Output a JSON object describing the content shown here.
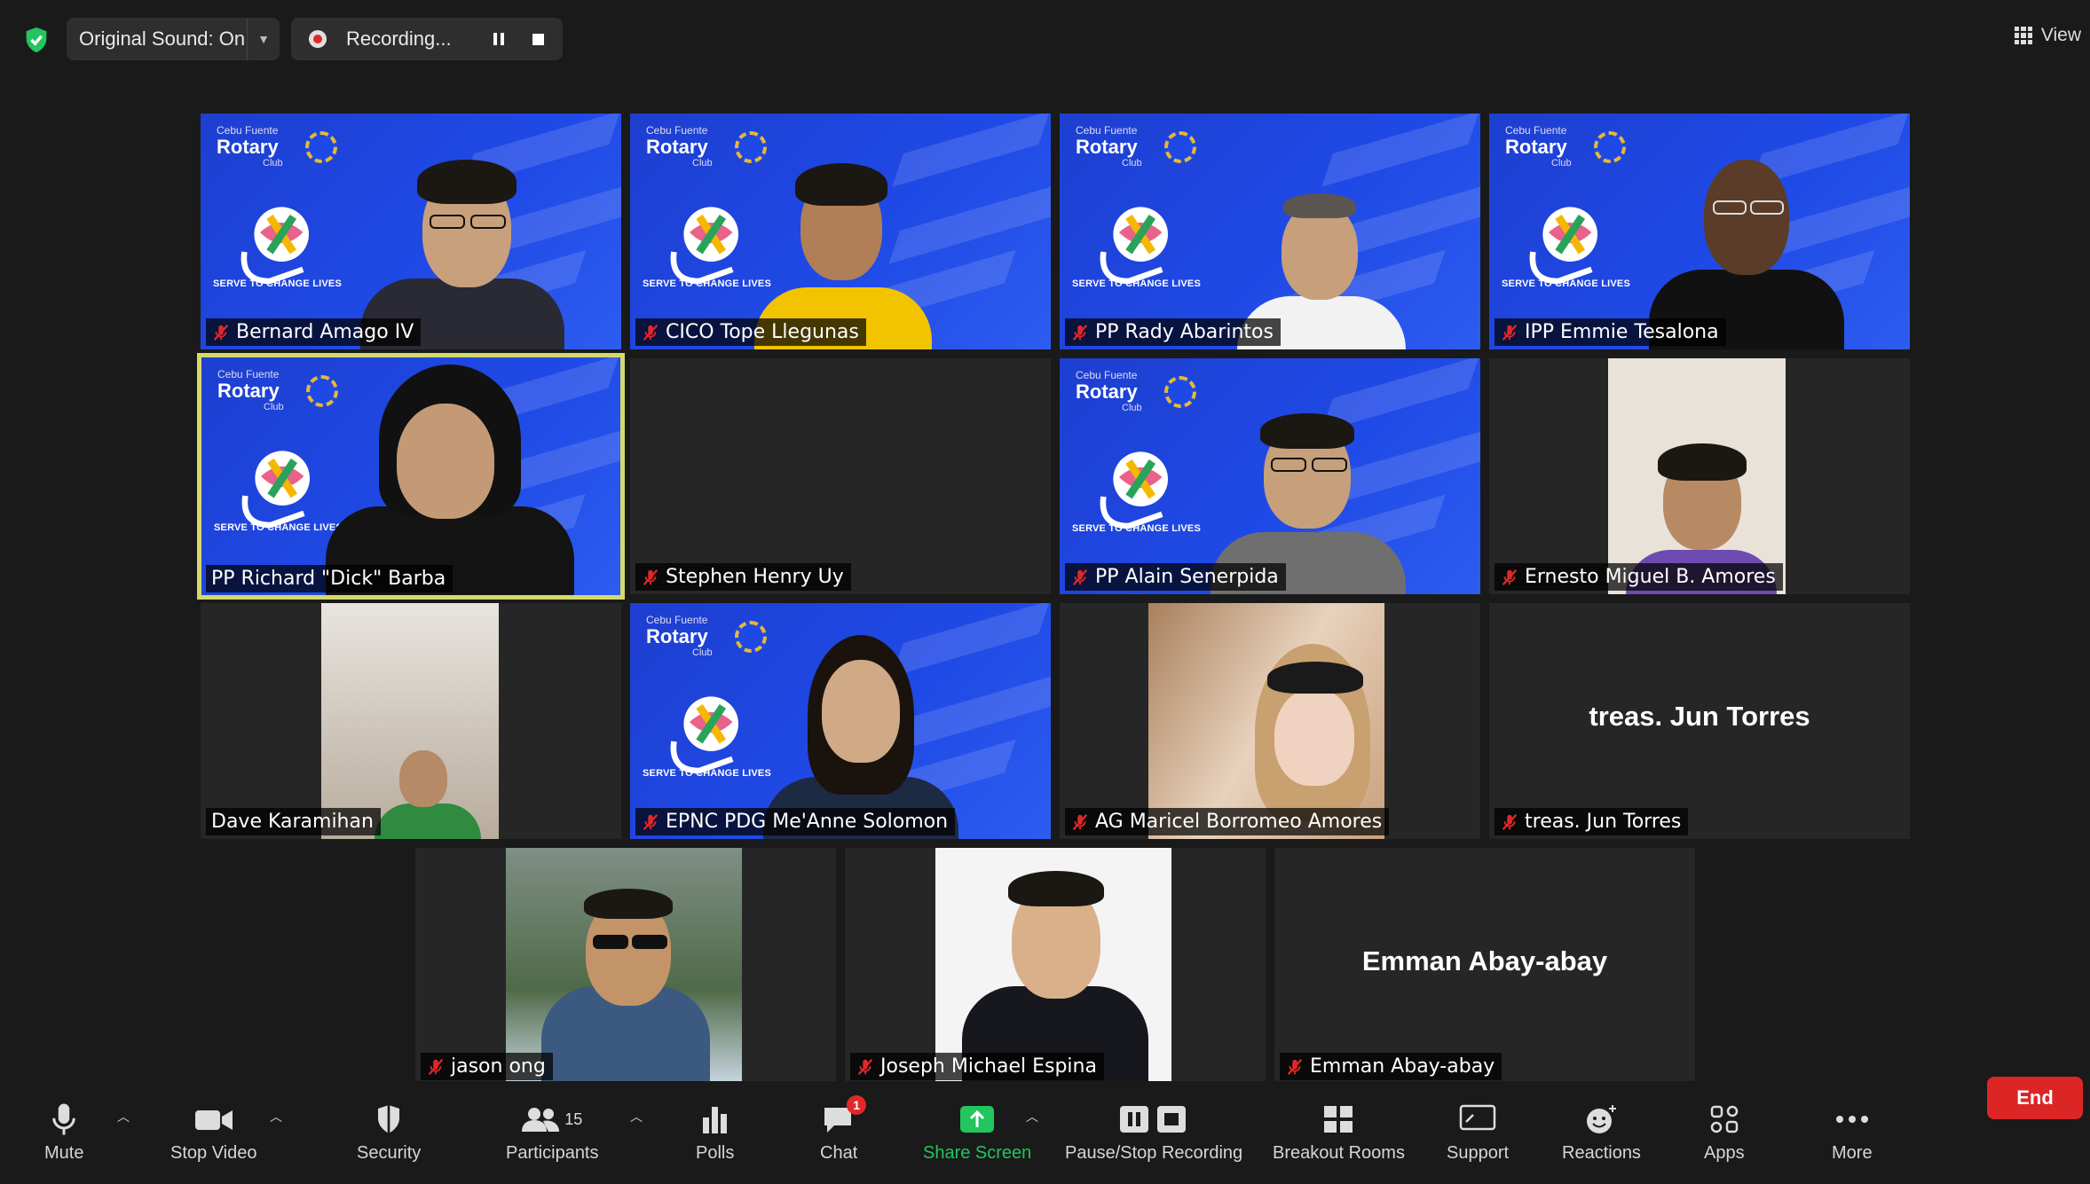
{
  "topbar": {
    "original_sound": "Original Sound: On",
    "recording": "Recording...",
    "view": "View"
  },
  "brand": {
    "top": "Cebu Fuente",
    "name": "Rotary",
    "club": "Club",
    "tagline": "SERVE TO CHANGE LIVES"
  },
  "participants": [
    {
      "name": "Bernard Amago IV",
      "muted": true
    },
    {
      "name": "CICO Tope Llegunas",
      "muted": true
    },
    {
      "name": "PP Rady Abarintos",
      "muted": true
    },
    {
      "name": "IPP Emmie Tesalona",
      "muted": true
    },
    {
      "name": "PP Richard \"Dick\" Barba",
      "muted": false,
      "active_speaker": true
    },
    {
      "name": "Stephen Henry Uy",
      "muted": true
    },
    {
      "name": "PP Alain Senerpida",
      "muted": true
    },
    {
      "name": "Ernesto Miguel B. Amores",
      "muted": true
    },
    {
      "name": "Dave Karamihan",
      "muted": false
    },
    {
      "name": "EPNC PDG Me'Anne Solomon",
      "muted": true
    },
    {
      "name": "AG Maricel Borromeo Amores",
      "muted": true
    },
    {
      "name": "treas. Jun Torres",
      "muted": true,
      "no_video_name": "treas. Jun Torres"
    },
    {
      "name": "jason ong",
      "muted": true
    },
    {
      "name": "Joseph Michael Espina",
      "muted": true
    },
    {
      "name": "Emman Abay-abay",
      "muted": true,
      "no_video_name": "Emman Abay-abay"
    }
  ],
  "toolbar": {
    "mute": "Mute",
    "stop_video": "Stop Video",
    "security": "Security",
    "participants": "Participants",
    "participants_count": "15",
    "polls": "Polls",
    "chat": "Chat",
    "chat_badge": "1",
    "share_screen": "Share Screen",
    "pause_stop_recording": "Pause/Stop Recording",
    "breakout_rooms": "Breakout Rooms",
    "support": "Support",
    "reactions": "Reactions",
    "apps": "Apps",
    "more": "More",
    "end": "End"
  },
  "colors": {
    "background": "#1a1a1a",
    "active_speaker_border": "#d4d96a",
    "rotary_blue": "#1f49e6",
    "end_button": "#dc2626",
    "share_green": "#22c55e",
    "muted_red": "#e02828"
  }
}
